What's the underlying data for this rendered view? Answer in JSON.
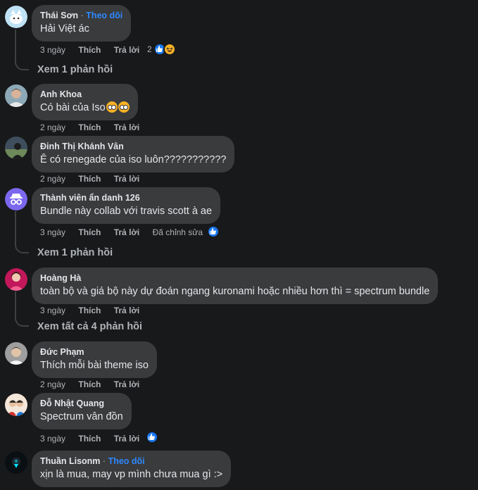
{
  "comments": [
    {
      "author": "Thái Sơn",
      "follow": "Theo dõi",
      "text": "Hải Việt ác",
      "time": "3 ngày",
      "like": "Thích",
      "reply": "Trả lời",
      "reaction_count": "2",
      "view_replies": "Xem 1 phản hồi"
    },
    {
      "author": "Anh Khoa",
      "text": "Có bài của Iso",
      "time": "2 ngày",
      "like": "Thích",
      "reply": "Trả lời"
    },
    {
      "author": "Đinh Thị Khánh Vân",
      "text": "Ê có renegade của iso luôn???????????",
      "time": "2 ngày",
      "like": "Thích",
      "reply": "Trả lời"
    },
    {
      "author": "Thành viên ẩn danh 126",
      "text": "Bundle này collab với travis scott à ae",
      "time": "3 ngày",
      "like": "Thích",
      "reply": "Trả lời",
      "edited": "Đã chỉnh sửa",
      "view_replies": "Xem 1 phản hồi"
    },
    {
      "author": "Hoàng Hà",
      "text": "toàn bộ và giá bộ này dự đoán ngang kuronami hoặc nhiều hơn thì = spectrum bundle",
      "time": "3 ngày",
      "like": "Thích",
      "reply": "Trả lời",
      "view_replies": "Xem tất cả 4 phản hồi"
    },
    {
      "author": "Đức Phạm",
      "text": "Thích mỗi bài theme iso",
      "time": "2 ngày",
      "like": "Thích",
      "reply": "Trả lời"
    },
    {
      "author": "Đỗ Nhật Quang",
      "text": "Spectrum vân đồn",
      "time": "3 ngày",
      "like": "Thích",
      "reply": "Trả lời"
    },
    {
      "author": "Thuần Lisonm",
      "follow": "Theo dõi",
      "text": "xịn là mua, may vp mình chưa mua gì :>"
    }
  ],
  "colors": {
    "background": "#18191a",
    "bubble": "#3a3b3c",
    "link": "#2d88ff",
    "muted": "#b0b3b8",
    "like_blue": "#1877f2",
    "haha_yellow": "#f7b125"
  }
}
